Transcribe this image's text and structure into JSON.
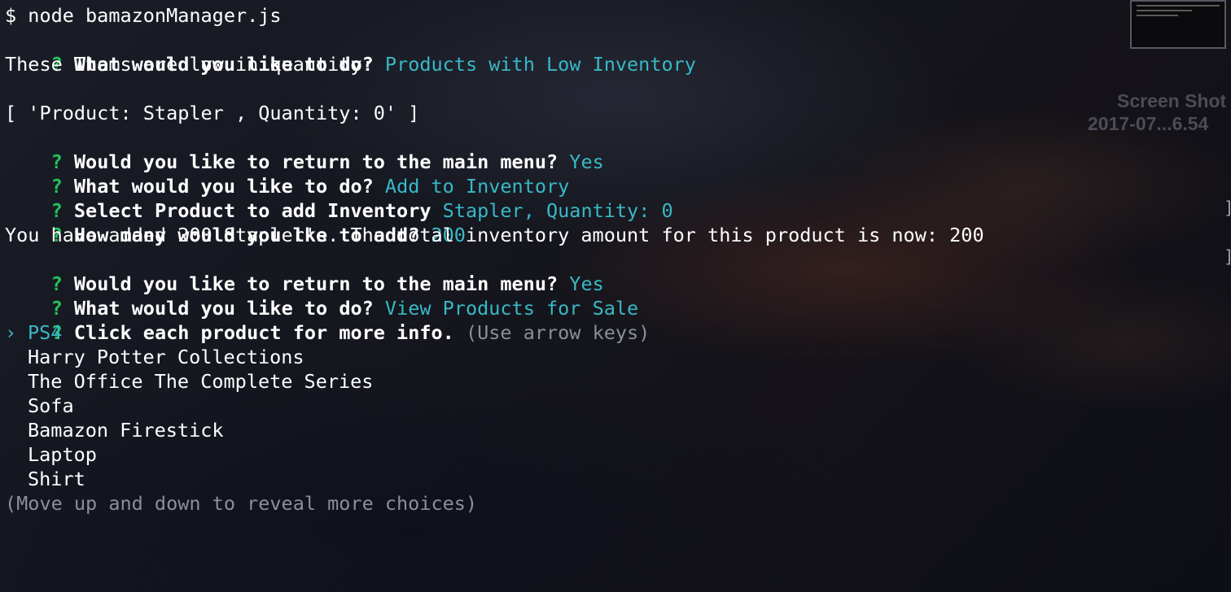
{
  "desktop": {
    "file_name": "Screen Shot",
    "file_date": "2017-07...6.54"
  },
  "terminal": {
    "prompt": "$ node bamazonManager.js",
    "qmark": "?",
    "cursor": "›",
    "q1": {
      "question": "What would you like to do?",
      "answer": "Products with Low Inventory"
    },
    "low_msg": "These Items are low in quantity:",
    "low_array": "[ 'Product: Stapler , Quantity: 0' ]",
    "q2": {
      "question": "Would you like to return to the main menu?",
      "answer": "Yes"
    },
    "q3": {
      "question": "What would you like to do?",
      "answer": "Add to Inventory"
    },
    "q4": {
      "question": "Select Product to add Inventory",
      "answer": "Stapler, Quantity: 0"
    },
    "q5": {
      "question": "How many would you lke to add?",
      "answer": "200"
    },
    "added_msg": "You have added 200 Stapler's. The total inventory amount for this product is now: 200",
    "q6": {
      "question": "Would you like to return to the main menu?",
      "answer": "Yes"
    },
    "q7": {
      "question": "What would you like to do?",
      "answer": "View Products for Sale"
    },
    "q8": {
      "question": "Click each product for more info.",
      "hint": "(Use arrow keys)"
    },
    "choices": [
      "PS4",
      "Harry Potter Collections",
      "The Office The Complete Series",
      "Sofa",
      "Bamazon Firestick",
      "Laptop",
      "Shirt"
    ],
    "more_hint": "(Move up and down to reveal more choices)"
  },
  "colors": {
    "answer": "#38b9c7",
    "qmark": "#21c55d",
    "hint": "#8a8f99"
  }
}
